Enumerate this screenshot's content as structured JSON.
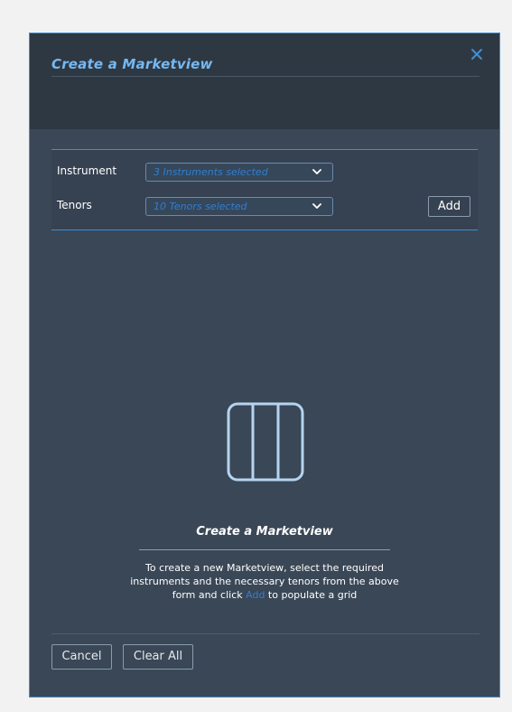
{
  "dialog": {
    "title": "Create a Marketview",
    "close_icon": "close-icon"
  },
  "form": {
    "instrument_label": "Instrument",
    "instrument_value": "3 Instruments selected",
    "tenors_label": "Tenors",
    "tenors_value": "10 Tenors selected",
    "add_label": "Add"
  },
  "empty_state": {
    "icon": "columns-grid-icon",
    "title": "Create a Marketview",
    "desc_before": "To create a new Marketview, select the required instruments and the necessary tenors from the above form and click ",
    "desc_link": "Add",
    "desc_after": " to populate a grid"
  },
  "footer": {
    "cancel_label": "Cancel",
    "clear_all_label": "Clear All"
  },
  "colors": {
    "accent": "#3f8fd6",
    "title": "#76b9f2",
    "panel": "#3a4756",
    "header": "#2e3843"
  }
}
